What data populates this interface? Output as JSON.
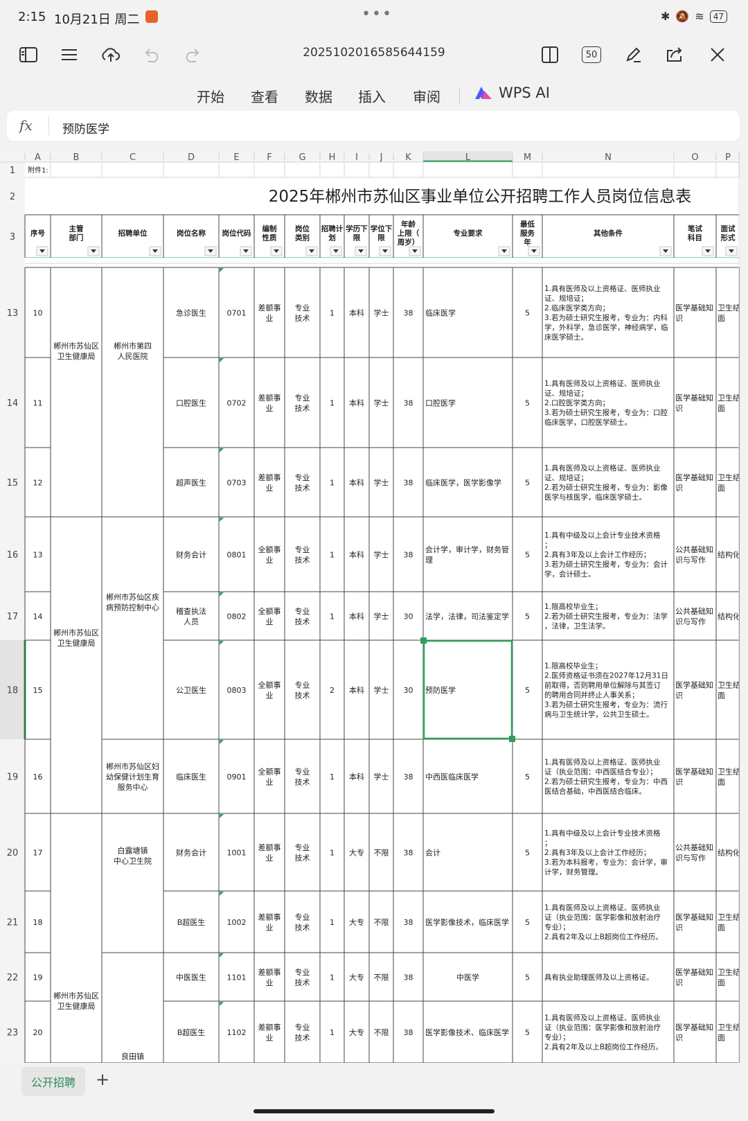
{
  "status_bar": {
    "time": "2:15",
    "date": "10月21日 周二",
    "battery": "47"
  },
  "toolbar": {
    "doc_name": "20251020165856441​59",
    "tab_count": "50"
  },
  "menu": {
    "items": [
      "开始",
      "查看",
      "数据",
      "插入",
      "审阅"
    ],
    "ai_label": "WPS AI"
  },
  "formula_bar": {
    "fx": "fx",
    "content": "预防医学"
  },
  "sheet": {
    "columns": [
      "A",
      "B",
      "C",
      "D",
      "E",
      "F",
      "G",
      "H",
      "I",
      "J",
      "K",
      "L",
      "M",
      "N",
      "O",
      "P"
    ],
    "row1_note": "附件1:",
    "title": "2025年郴州市苏仙区事业单位公开招聘工作人员岗位信息表",
    "headers": [
      "序号",
      "主管\n部门",
      "招聘单位",
      "岗位名称",
      "岗位代码",
      "编制\n性质",
      "岗位\n类别",
      "招聘计\n划",
      "学历下\n限",
      "学位下\n限",
      "年龄\n上限（\n周岁）",
      "专业要求",
      "最低\n服务\n年",
      "其他条件",
      "笔试\n科目",
      "面试\n形式"
    ],
    "rows": [
      {
        "rownum": "13",
        "seq": "10",
        "post": "急诊医生",
        "code": "0701",
        "nature": "差额事\n业",
        "category": "专业\n技术",
        "plan": "1",
        "edu": "本科",
        "degree": "学士",
        "age": "38",
        "major": "临床医学",
        "service": "5",
        "other": "1.具有医师及以上资格证、医师执业\n证、规培证；\n2.临床医学类方向；\n3.若为硕士研究生报考，专业为：内科\n学，外科学，急诊医学，神经病学，临\n床医学硕士。",
        "exam": "医学基础知\n识",
        "interview": "卫生结\n面"
      },
      {
        "rownum": "14",
        "seq": "11",
        "post": "口腔医生",
        "code": "0702",
        "nature": "差额事\n业",
        "category": "专业\n技术",
        "plan": "1",
        "edu": "本科",
        "degree": "学士",
        "age": "38",
        "major": "口腔医学",
        "service": "5",
        "other": "1.具有医师及以上资格证、医师执业\n证、规培证；\n2.口腔医学类方向；\n3.若为硕士研究生报考，专业为：口腔\n临床医学，口腔医学硕士。",
        "exam": "医学基础知\n识",
        "interview": "卫生结\n面"
      },
      {
        "rownum": "15",
        "seq": "12",
        "post": "超声医生",
        "code": "0703",
        "nature": "差额事\n业",
        "category": "专业\n技术",
        "plan": "1",
        "edu": "本科",
        "degree": "学士",
        "age": "38",
        "major": "临床医学，医学影像学",
        "service": "5",
        "other": "1.具有医师及以上资格证、医师执业\n证、规培证；\n2.若为硕士研究生报考，专业为：影像\n医学与核医学，临床医学硕士。",
        "exam": "医学基础知\n识",
        "interview": "卫生结\n面"
      },
      {
        "rownum": "16",
        "seq": "13",
        "post": "财务会计",
        "code": "0801",
        "nature": "全额事\n业",
        "category": "专业\n技术",
        "plan": "1",
        "edu": "本科",
        "degree": "学士",
        "age": "38",
        "major": "会计学，审计学，财务管\n理",
        "service": "5",
        "other": "1.具有中级及以上会计专业技术资格\n；\n2.具有3年及以上会计工作经历；\n3.若为硕士研究生报考，专业为：会计\n学，会计硕士。",
        "exam": "公共基础知\n识与写作",
        "interview": "结构化"
      },
      {
        "rownum": "17",
        "seq": "14",
        "post": "稽查执法\n人员",
        "code": "0802",
        "nature": "全额事\n业",
        "category": "专业\n技术",
        "plan": "1",
        "edu": "本科",
        "degree": "学士",
        "age": "30",
        "major": "法学，法律，司法鉴定学",
        "service": "5",
        "other": "1.限高校毕业生；\n2.若为硕士研究生报考，专业为：法学\n，法律，卫生法学。",
        "exam": "公共基础知\n识与写作",
        "interview": "结构化"
      },
      {
        "rownum": "18",
        "seq": "15",
        "post": "公卫医生",
        "code": "0803",
        "nature": "全额事\n业",
        "category": "专业\n技术",
        "plan": "2",
        "edu": "本科",
        "degree": "学士",
        "age": "30",
        "major": "预防医学",
        "service": "5",
        "other": "1.限高校毕业生；\n2.医师资格证书须在2027年12月31日\n前取得，否则聘用单位解除与其签订\n的聘用合同并终止人事关系；\n3.若为硕士研究生报考，专业为：流行\n病与卫生统计学，公共卫生硕士。",
        "exam": "医学基础知\n识",
        "interview": "卫生结\n面"
      },
      {
        "rownum": "19",
        "seq": "16",
        "post": "临床医生",
        "code": "0901",
        "nature": "全额事\n业",
        "category": "专业\n技术",
        "plan": "1",
        "edu": "本科",
        "degree": "学士",
        "age": "38",
        "major": "中西医临床医学",
        "service": "5",
        "other": "1.具有医师及以上资格证、医师执业\n证（执业范围：中西医结合专业）；\n2.若为硕士研究生报考，专业为：中西\n医结合基础，中西医结合临床。",
        "exam": "医学基础知\n识",
        "interview": "卫生结\n面"
      },
      {
        "rownum": "20",
        "seq": "17",
        "post": "财务会计",
        "code": "1001",
        "nature": "差额事\n业",
        "category": "专业\n技术",
        "plan": "1",
        "edu": "大专",
        "degree": "不限",
        "age": "38",
        "major": "会计",
        "service": "5",
        "other": "1.具有中级及以上会计专业技术资格\n；\n2.具有3年及以上会计工作经历；\n3.若为本科报考，专业为：会计学，审\n计学，财务管理。",
        "exam": "公共基础知\n识与写作",
        "interview": "结构化"
      },
      {
        "rownum": "21",
        "seq": "18",
        "post": "B超医生",
        "code": "1002",
        "nature": "差额事\n业",
        "category": "专业\n技术",
        "plan": "1",
        "edu": "大专",
        "degree": "不限",
        "age": "38",
        "major": "医学影像技术，临床医学",
        "service": "5",
        "other": "1.具有医师及以上资格证、医师执业\n证（执业范围：医学影像和放射治疗\n专业）；\n2.具有2年及以上B超岗位工作经历。",
        "exam": "医学基础知\n识",
        "interview": "卫生结\n面"
      },
      {
        "rownum": "22",
        "seq": "19",
        "post": "中医医生",
        "code": "1101",
        "nature": "差额事\n业",
        "category": "专业\n技术",
        "plan": "1",
        "edu": "大专",
        "degree": "不限",
        "age": "38",
        "major": "中医学",
        "service": "5",
        "other": "具有执业助理医师及以上资格证。",
        "exam": "医学基础知\n识",
        "interview": "卫生结\n面"
      },
      {
        "rownum": "23",
        "seq": "20",
        "post": "B超医生",
        "code": "1102",
        "nature": "差额事\n业",
        "category": "专业\n技术",
        "plan": "1",
        "edu": "大专",
        "degree": "不限",
        "age": "38",
        "major": "医学影像技术、临床医学",
        "service": "5",
        "other": "1.具有医师及以上资格证、医师执业\n证（执业范围：医学影像和放射治疗\n专业）；\n2.具有2年及以上B超岗位工作经历。",
        "exam": "医学基础知\n识",
        "interview": "卫生结\n面"
      }
    ],
    "merged": {
      "dept_1": "郴州市苏仙区\n卫生健康局",
      "unit_1": "郴州市第四\n人民医院",
      "dept_2": "郴州市苏仙区\n卫生健康局",
      "unit_2": "郴州市苏仙区疾\n病预防控制中心",
      "unit_3": "郴州市苏仙区妇\n幼保健计划生育\n服务中心",
      "unit_4": "白露塘镇\n中心卫生院",
      "dept_3": "郴州市苏仙区\n卫生健康局",
      "unit_5": "良田镇"
    }
  },
  "bottom": {
    "sheet_tab": "公开招聘",
    "add": "+"
  },
  "colors": {
    "accent": "#2e9e5b",
    "grid": "#d4d4d4",
    "cellborder": "#444444"
  }
}
